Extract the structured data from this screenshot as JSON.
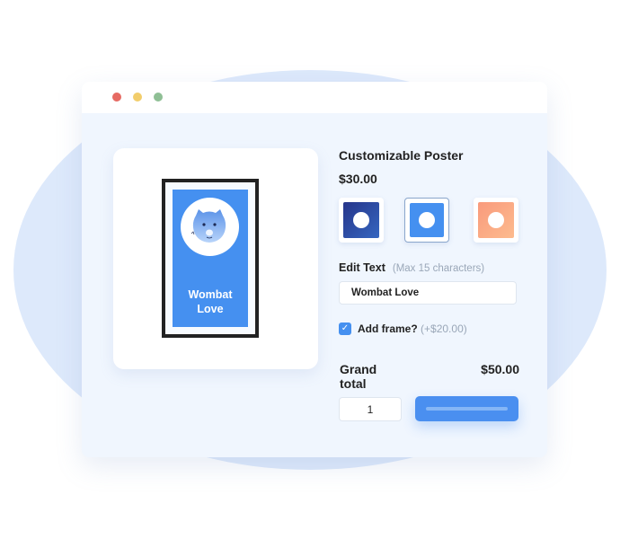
{
  "window": {
    "controls": [
      "close",
      "minimize",
      "maximize"
    ]
  },
  "preview": {
    "poster_text": "Wombat\nLove",
    "poster_color": "#4590f0",
    "frame_color": "#222222",
    "image": "wombat-face-icon"
  },
  "product": {
    "title": "Customizable Poster",
    "price": "$30.00",
    "swatches": [
      {
        "name": "navy",
        "color_from": "#2a3e96",
        "color_to": "#2f5cb8",
        "selected": false
      },
      {
        "name": "blue",
        "color_from": "#4590f0",
        "color_to": "#4590f0",
        "selected": true
      },
      {
        "name": "peach",
        "color_from": "#fdb58a",
        "color_to": "#f79a7a",
        "selected": false
      }
    ],
    "edit_text_label": "Edit Text",
    "edit_text_hint": "(Max 15 characters)",
    "edit_text_value": "Wombat Love",
    "frame_option_label": "Add frame?",
    "frame_option_price": "(+$20.00)",
    "frame_option_checked": true,
    "check_glyph": "✓",
    "grand_total_label": "Grand total",
    "grand_total_value": "$50.00",
    "quantity": "1",
    "accent": "#4a8ff0"
  }
}
